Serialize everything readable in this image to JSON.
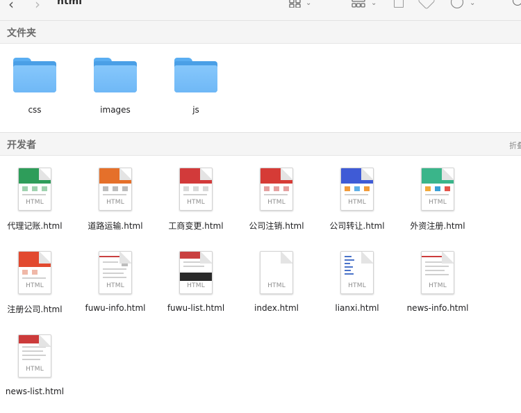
{
  "toolbar": {
    "title": "html",
    "back_glyph": "‹",
    "forward_glyph": "›",
    "icons": [
      "chevron-left-icon",
      "chevron-right-icon",
      "grid-view-icon",
      "group-icon",
      "share-icon",
      "tag-icon",
      "more-icon",
      "search-icon"
    ]
  },
  "sections": {
    "folders": {
      "title": "文件夹"
    },
    "developer": {
      "title": "开发者",
      "collapse_label": "折叠"
    }
  },
  "folders": [
    {
      "name": "css"
    },
    {
      "name": "images"
    },
    {
      "name": "js"
    }
  ],
  "files": [
    {
      "name": "代理记账.html",
      "badge": "HTML",
      "accent": "#2e9d5a"
    },
    {
      "name": "道路运输.html",
      "badge": "HTML",
      "accent": "#e5702a"
    },
    {
      "name": "工商变更.html",
      "badge": "HTML",
      "accent": "#d23a3a"
    },
    {
      "name": "公司注销.html",
      "badge": "HTML",
      "accent": "#d63b36"
    },
    {
      "name": "公司转让.html",
      "badge": "HTML",
      "accent": "#3f5bd6"
    },
    {
      "name": "外资注册.html",
      "badge": "HTML",
      "accent": "#3ab58a"
    },
    {
      "name": "注册公司.html",
      "badge": "HTML",
      "accent": "#e2492f"
    },
    {
      "name": "fuwu-info.html",
      "badge": "HTML",
      "accent": "#c94040"
    },
    {
      "name": "fuwu-list.html",
      "badge": "HTML",
      "accent": "#2a2a2a"
    },
    {
      "name": "index.html",
      "badge": "HTML",
      "accent": "#ffffff"
    },
    {
      "name": "lianxi.html",
      "badge": "HTML",
      "accent": "#4a73c9"
    },
    {
      "name": "news-info.html",
      "badge": "HTML",
      "accent": "#cc3b3b"
    },
    {
      "name": "news-list.html",
      "badge": "HTML",
      "accent": "#cc3b3b"
    }
  ]
}
